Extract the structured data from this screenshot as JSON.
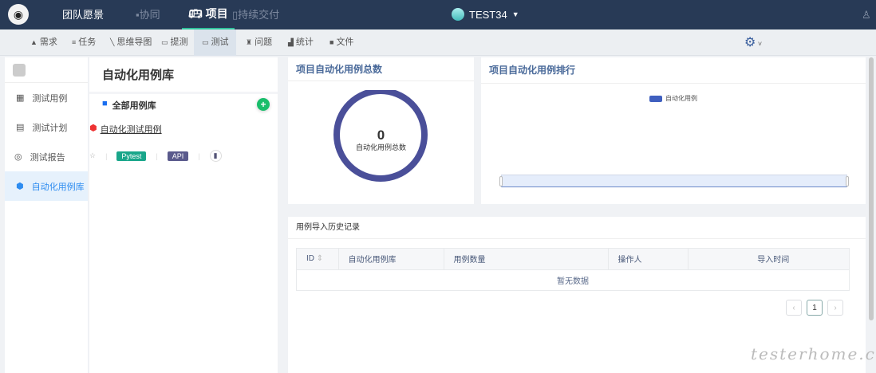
{
  "topbar": {
    "nav": [
      "团队愿景",
      "协同",
      "项目",
      "持续交付"
    ],
    "project": "TEST34"
  },
  "subnav": [
    "需求",
    "任务",
    "思维导图",
    "提测",
    "测试",
    "问题",
    "统计",
    "文件"
  ],
  "sidebar": [
    "测试用例",
    "测试计划",
    "测试报告",
    "自动化用例库"
  ],
  "library": {
    "title": "自动化用例库",
    "all": "全部用例库",
    "item": "自动化测试用例",
    "tags": [
      "Pytest",
      "API"
    ]
  },
  "total_card": {
    "title": "项目自动化用例总数",
    "value": "0",
    "label": "自动化用例总数"
  },
  "rank_card": {
    "title": "项目自动化用例排行",
    "legend": "自动化用例"
  },
  "history": {
    "title": "用例导入历史记录",
    "columns": [
      "ID",
      "自动化用例库",
      "用例数量",
      "操作人",
      "导入时间"
    ],
    "empty": "暂无数据",
    "page": "1"
  },
  "watermark": "testerhome.com"
}
